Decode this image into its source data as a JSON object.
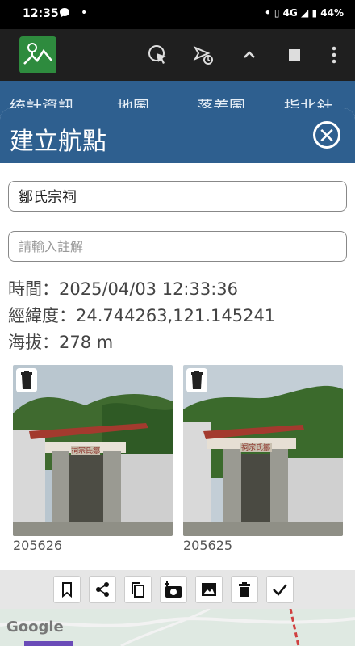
{
  "status_bar": {
    "time": "12:35",
    "signal_text": "4G",
    "battery": "44%",
    "icons": [
      "message-icon",
      "vibrate-icon",
      "signal-icon",
      "battery-icon"
    ]
  },
  "app_bar": {
    "icons": [
      "app-logo-icon",
      "cursor-click-icon",
      "route-time-icon",
      "chevron-up-icon",
      "stop-icon",
      "more-vert-icon"
    ]
  },
  "tabs": [
    {
      "label": "統計資訊"
    },
    {
      "label": "地圖"
    },
    {
      "label": "落差圖"
    },
    {
      "label": "指北針"
    }
  ],
  "modal": {
    "title": "建立航點",
    "name_value": "鄒氏宗祠",
    "note_placeholder": "請輸入註解",
    "time_line": "時間：2025/04/03 12:33:36",
    "coords_line": "經緯度：24.744263,121.145241",
    "altitude_line": "海拔：278 m",
    "photos": [
      {
        "caption": "205626",
        "sign_text": "祠宗氏鄒"
      },
      {
        "caption": "205625",
        "sign_text": "祠宗氏鄒"
      }
    ],
    "actions": [
      "bookmark-icon",
      "share-icon",
      "copy-icon",
      "camera-add-icon",
      "image-icon",
      "delete-icon",
      "check-icon"
    ]
  },
  "map": {
    "attribution": "Google"
  },
  "colors": {
    "header_blue": "#2e5f8f",
    "logo_green": "#2e8b3e"
  }
}
